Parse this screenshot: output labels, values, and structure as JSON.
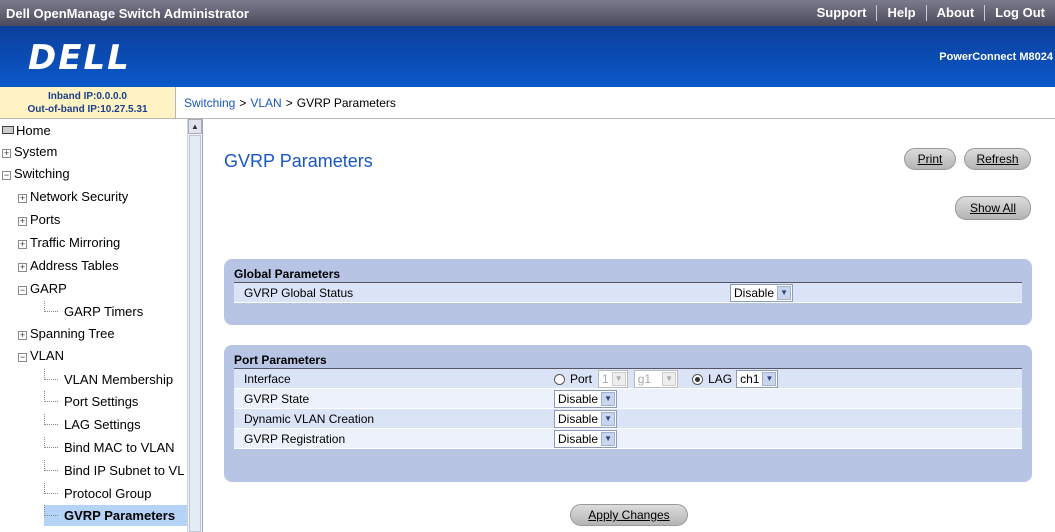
{
  "app": {
    "title": "Dell OpenManage Switch Administrator",
    "links": [
      "Support",
      "Help",
      "About",
      "Log Out"
    ],
    "logo": "DELL",
    "model": "PowerConnect M8024"
  },
  "ipinfo": {
    "inband": "Inband IP:0.0.0.0",
    "oob": "Out-of-band IP:10.27.5.31"
  },
  "breadcrumb": [
    "Switching",
    "VLAN",
    "GVRP Parameters"
  ],
  "tree": [
    {
      "label": "Home",
      "expander": "none"
    },
    {
      "label": "System",
      "expander": "+"
    },
    {
      "label": "Switching",
      "expander": "-"
    },
    {
      "label": "Network Security",
      "expander": "+"
    },
    {
      "label": "Ports",
      "expander": "+"
    },
    {
      "label": "Traffic Mirroring",
      "expander": "+"
    },
    {
      "label": "Address Tables",
      "expander": "+"
    },
    {
      "label": "GARP",
      "expander": "-"
    },
    {
      "label": "GARP Timers",
      "expander": "leaf"
    },
    {
      "label": "Spanning Tree",
      "expander": "+"
    },
    {
      "label": "VLAN",
      "expander": "-"
    },
    {
      "label": "VLAN Membership",
      "expander": "leaf"
    },
    {
      "label": "Port Settings",
      "expander": "leaf"
    },
    {
      "label": "LAG Settings",
      "expander": "leaf"
    },
    {
      "label": "Bind MAC to VLAN",
      "expander": "leaf"
    },
    {
      "label": "Bind IP Subnet to VL",
      "expander": "leaf"
    },
    {
      "label": "Protocol Group",
      "expander": "leaf"
    },
    {
      "label": "GVRP Parameters",
      "expander": "leaf"
    }
  ],
  "page": {
    "title": "GVRP Parameters",
    "print": "Print",
    "refresh": "Refresh",
    "show_all": "Show All",
    "apply": "Apply Changes"
  },
  "global": {
    "title": "Global Parameters",
    "status_label": "GVRP Global Status",
    "status_value": "Disable"
  },
  "port": {
    "title": "Port Parameters",
    "interface_label": "Interface",
    "port_radio": "Port",
    "port_unit": "1",
    "port_slot": "g1",
    "lag_radio": "LAG",
    "lag_value": "ch1",
    "state_label": "GVRP State",
    "state_value": "Disable",
    "dynamic_label": "Dynamic VLAN Creation",
    "dynamic_value": "Disable",
    "registration_label": "GVRP Registration",
    "registration_value": "Disable"
  }
}
